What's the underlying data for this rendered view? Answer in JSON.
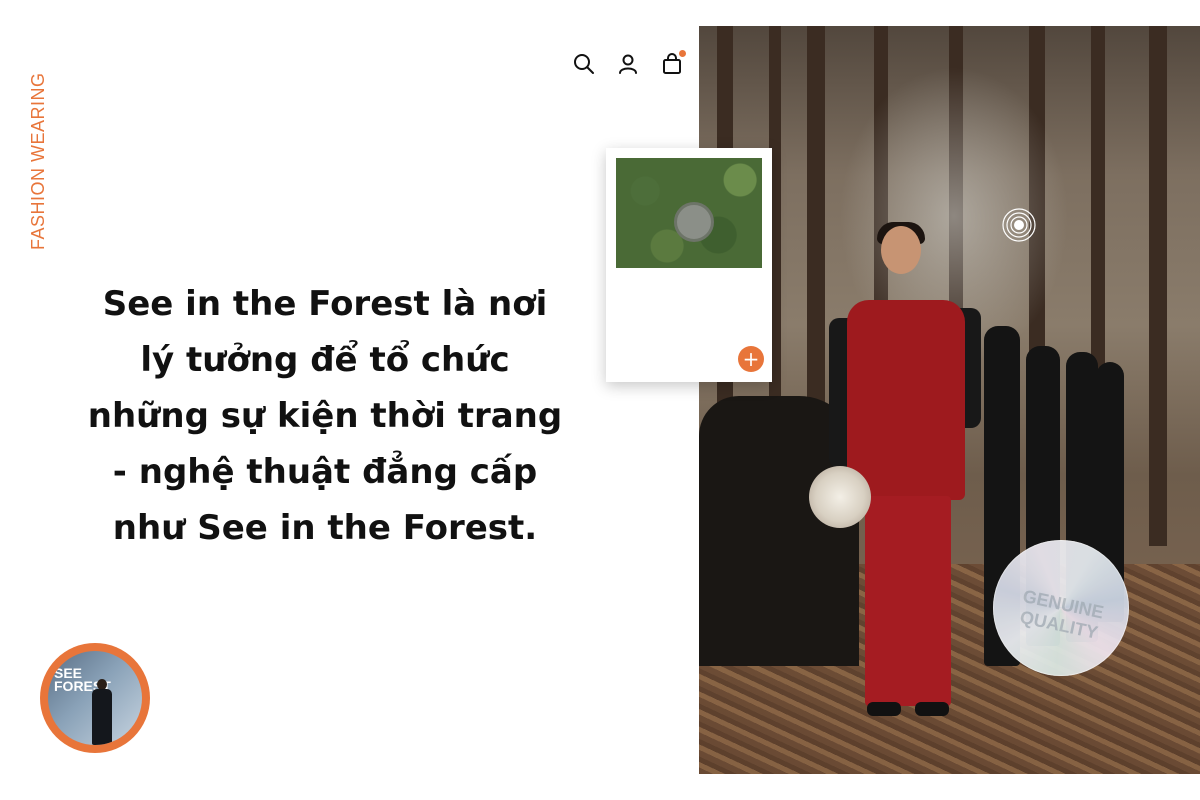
{
  "brand": {
    "vertical_label": "FASHION WEARING"
  },
  "header": {
    "icons": [
      "search-icon",
      "user-icon",
      "shopping-bag-icon",
      "menu-icon"
    ],
    "cart_indicator_color": "#e8753a"
  },
  "content": {
    "headline_lines": [
      "See in the Forest  là nơi",
      "lý tưởng để tổ chức",
      "những sự kiện thời trang",
      "- nghệ thuật đẳng cấp",
      "như See in the Forest."
    ]
  },
  "avatar": {
    "banner_text": "SEE FOREST"
  },
  "hero": {
    "badge_text": "GENUINE QUALITY"
  },
  "card": {
    "plus_label": "+"
  },
  "colors": {
    "accent": "#e8753a",
    "text": "#111111",
    "background": "#ffffff"
  }
}
